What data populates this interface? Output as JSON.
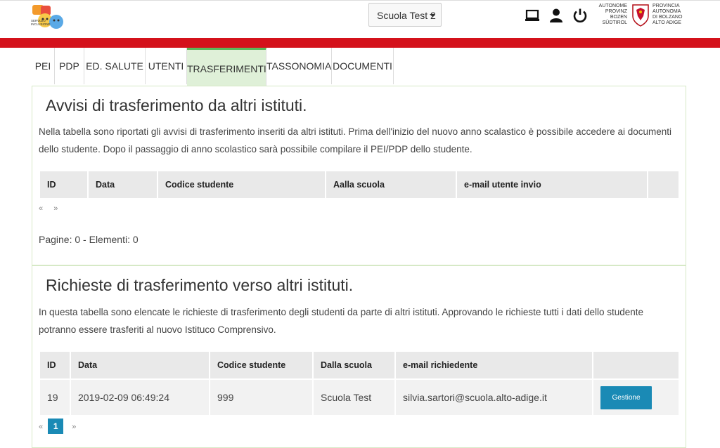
{
  "header": {
    "logo_text": "SERVIZIO INCLUSIONE",
    "school_select": "Scuola Test 2",
    "brand_de": [
      "AUTONOME",
      "PROVINZ",
      "BOZEN",
      "SÜDTIROL"
    ],
    "brand_it": [
      "PROVINCIA",
      "AUTONOMA",
      "DI BOLZANO",
      "ALTO ADIGE"
    ]
  },
  "tabs": [
    {
      "label": "PEI"
    },
    {
      "label": "PDP"
    },
    {
      "label": "ED. SALUTE"
    },
    {
      "label": "UTENTI"
    },
    {
      "label": "TRASFERIMENTI",
      "active": true
    },
    {
      "label": "TASSONOMIA"
    },
    {
      "label": "DOCUMENTI"
    }
  ],
  "incoming": {
    "title": "Avvisi di trasferimento da altri istituti.",
    "description": "Nella tabella sono riportati gli avvisi di trasferimento inseriti da altri istituti. Prima dell'inizio del nuovo anno scalastico è possibile accedere ai documenti dello studente. Dopo il passaggio di anno scolastico sarà possibile compilare il PEI/PDP dello studente.",
    "columns": [
      "ID",
      "Data",
      "Codice studente",
      "Aalla scuola",
      "e-mail utente invio",
      ""
    ],
    "pager_prev": "«",
    "pager_next": "»",
    "stats": "Pagine: 0 - Elementi: 0"
  },
  "outgoing": {
    "title": "Richieste di trasferimento verso altri istituti.",
    "description": "In questa tabella sono elencate le richieste di trasferimento degli studenti da parte di altri istituti. Approvando le richieste tutti i dati dello studente potranno essere trasferiti al nuovo Istituco Comprensivo.",
    "columns": [
      "ID",
      "Data",
      "Codice studente",
      "Dalla scuola",
      "e-mail richiedente",
      ""
    ],
    "rows": [
      {
        "id": "19",
        "data": "2019-02-09 06:49:24",
        "codice": "999",
        "scuola": "Scuola Test",
        "email": "silvia.sartori@scuola.alto-adige.it",
        "action": "Gestione"
      }
    ],
    "pager_prev": "«",
    "pager_page": "1",
    "pager_next": "»"
  },
  "colors": {
    "accent_red": "#d4111b",
    "accent_blue": "#1a8ab5",
    "tab_active_bg": "#dff0d8",
    "tab_active_border": "#5cb85c"
  },
  "icons": [
    "laptop-icon",
    "user-icon",
    "power-icon"
  ]
}
